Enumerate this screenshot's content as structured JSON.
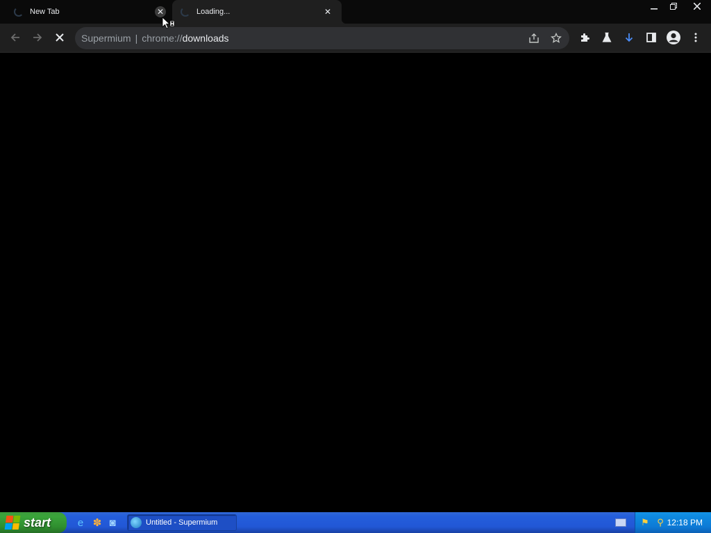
{
  "browser": {
    "tabs": [
      {
        "title": "New Tab"
      },
      {
        "title": "Loading..."
      }
    ],
    "window_controls": {
      "minimize": "—",
      "restore": "❐",
      "close": "✕"
    },
    "omnibox": {
      "host": "Supermium",
      "separator": "|",
      "url_prefix": "chrome://",
      "url_path": "downloads"
    }
  },
  "taskbar": {
    "start_label": "start",
    "task_button": "Untitled - Supermium",
    "clock": "12:18 PM"
  }
}
